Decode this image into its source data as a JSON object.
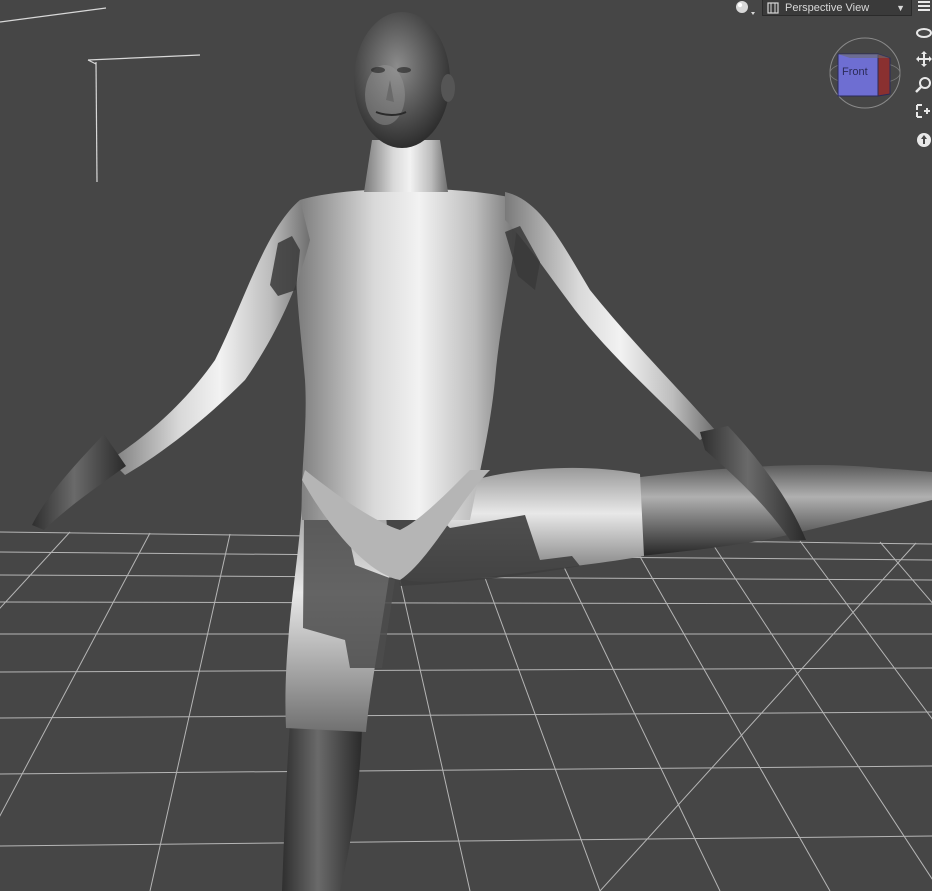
{
  "viewport": {
    "camera_label": "Perspective View",
    "background_color": "#464646",
    "grid_color": "#c8c8c8",
    "figure_base_color": "#8a8a8a"
  },
  "view_cube": {
    "face_label": "Front",
    "face_color": "#6b6bd0",
    "side_color": "#8a3030"
  },
  "toolbar": {
    "shading_icon": "sphere-shading-icon",
    "camera_icon": "camera-icon",
    "nav_icons": [
      "orbit-icon",
      "pan-icon",
      "zoom-icon",
      "frame-icon",
      "reset-view-icon"
    ]
  }
}
